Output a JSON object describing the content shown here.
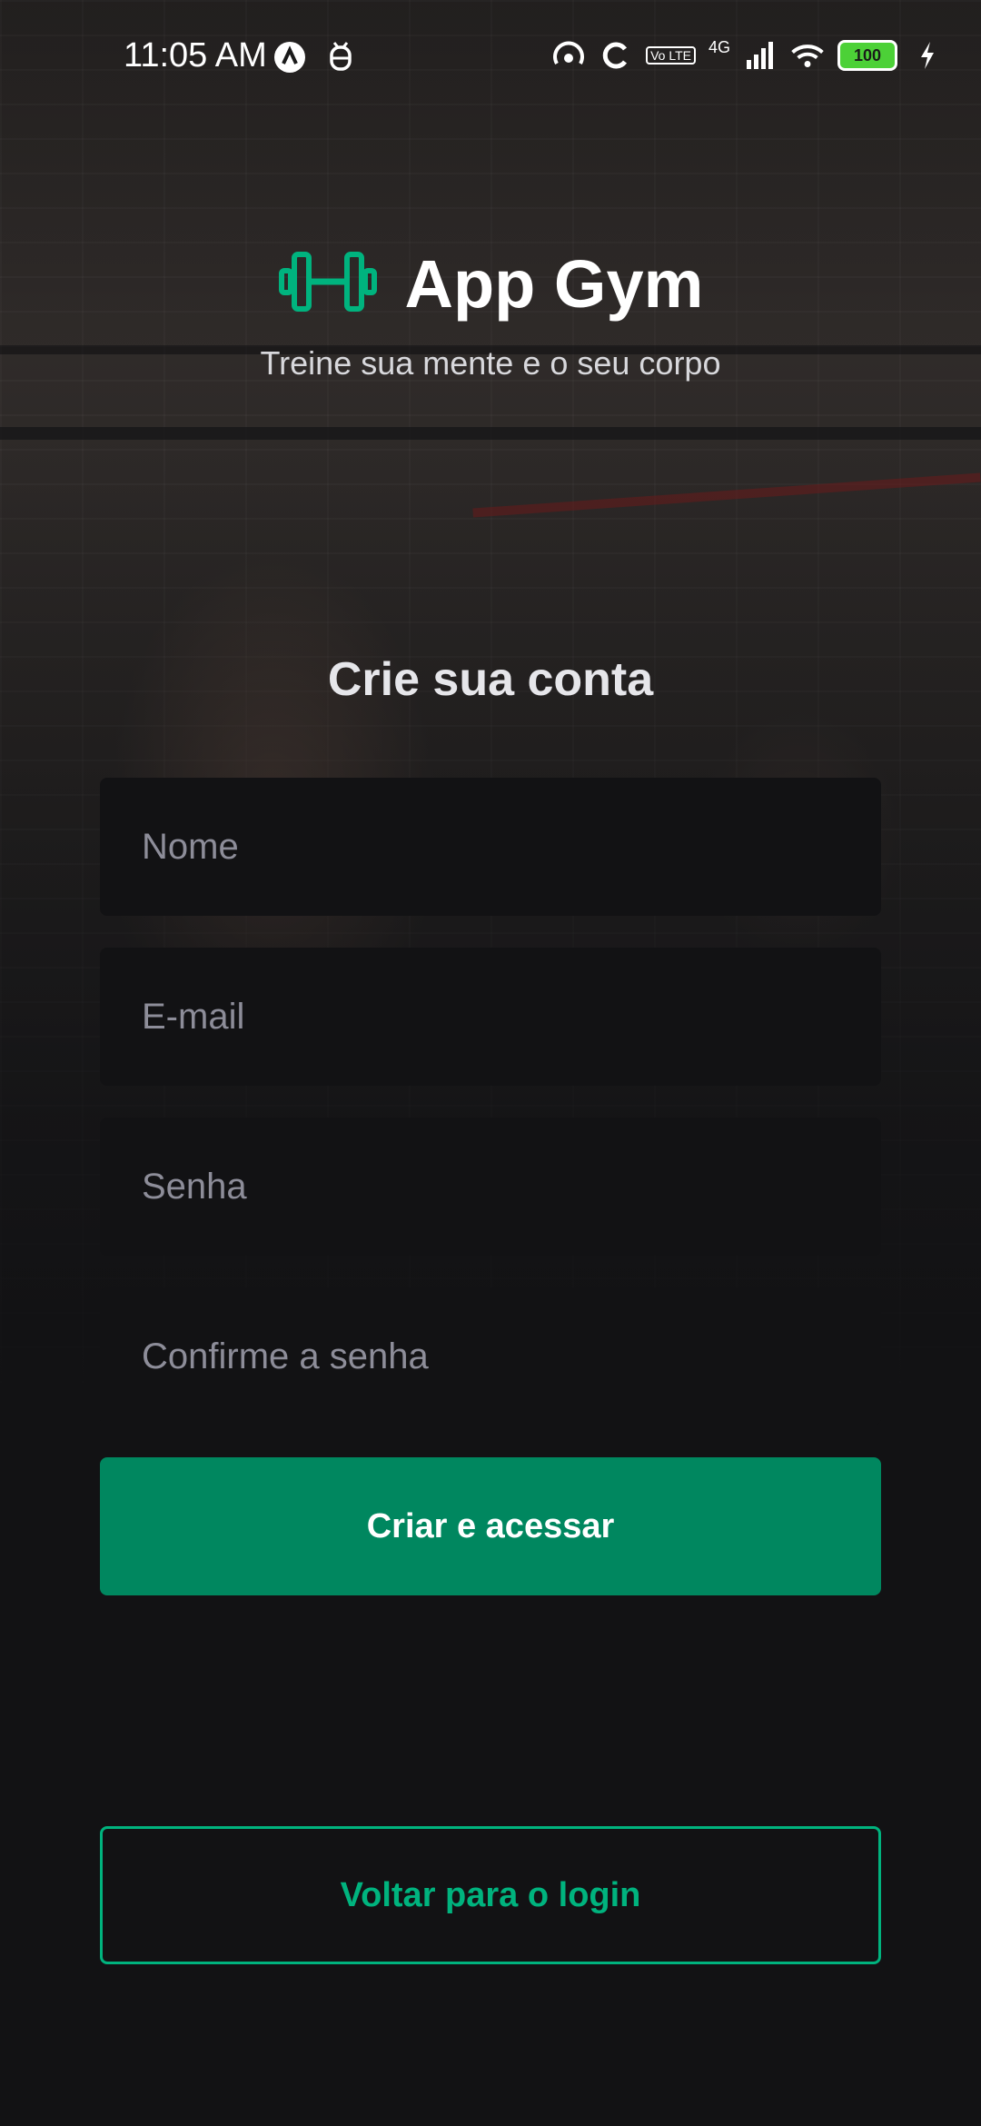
{
  "status_bar": {
    "time": "11:05 AM",
    "network_label": "4G",
    "volte_label": "Vo LTE",
    "battery_level": "100",
    "icons": [
      "app-notification-icon",
      "bug-icon",
      "hotspot-icon",
      "sync-icon",
      "volte-icon",
      "signal-icon",
      "wifi-icon",
      "battery-icon",
      "charging-icon"
    ]
  },
  "header": {
    "app_name": "App Gym",
    "tagline": "Treine sua mente e o seu corpo",
    "logo_icon": "dumbbell-icon",
    "logo_color": "#00b37e"
  },
  "form": {
    "title": "Crie sua conta",
    "fields": {
      "name_placeholder": "Nome",
      "email_placeholder": "E-mail",
      "password_placeholder": "Senha",
      "confirm_password_placeholder": "Confirme a senha"
    },
    "submit_label": "Criar e acessar"
  },
  "footer": {
    "back_to_login_label": "Voltar para o login"
  },
  "colors": {
    "background": "#121214",
    "primary": "#00875f",
    "accent": "#00b37e",
    "input_bg": "#121214",
    "placeholder": "#8d8d99"
  }
}
